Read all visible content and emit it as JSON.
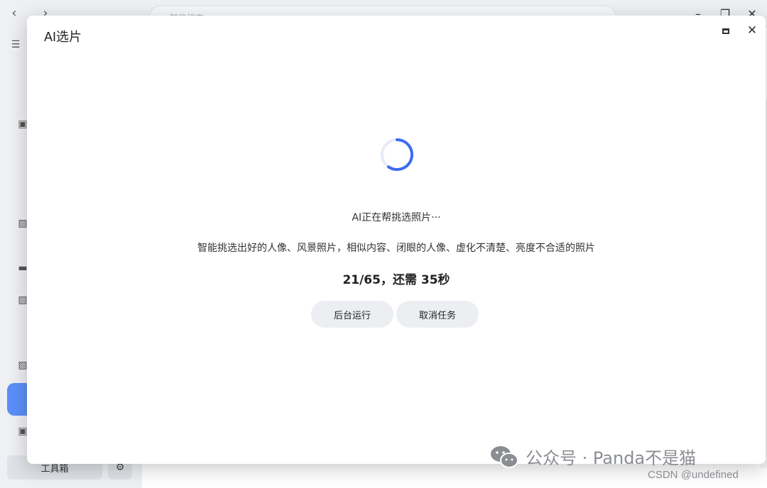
{
  "background": {
    "search_placeholder": "智能搜索",
    "tools_label": "工具箱"
  },
  "modal": {
    "title": "AI选片",
    "status_text": "AI正在帮挑选照片···",
    "description": "智能挑选出好的人像、风景照片，相似内容、闭眼的人像、虚化不清楚、亮度不合适的照片",
    "progress_text": "21/65，还需 35秒",
    "buttons": {
      "background_run": "后台运行",
      "cancel_task": "取消任务"
    }
  },
  "watermark": {
    "main": "公众号 · Panda不是猫",
    "sub": "CSDN @undefined"
  },
  "colors": {
    "accent": "#3b6cf6",
    "sidebar_active": "#5b8ff9"
  },
  "icons": [
    "back-icon",
    "forward-icon",
    "search-icon",
    "microphone-icon",
    "minimize-icon",
    "restore-icon",
    "close-icon",
    "menu-collapse-icon",
    "gear-icon",
    "spinner-icon",
    "wechat-icon"
  ]
}
